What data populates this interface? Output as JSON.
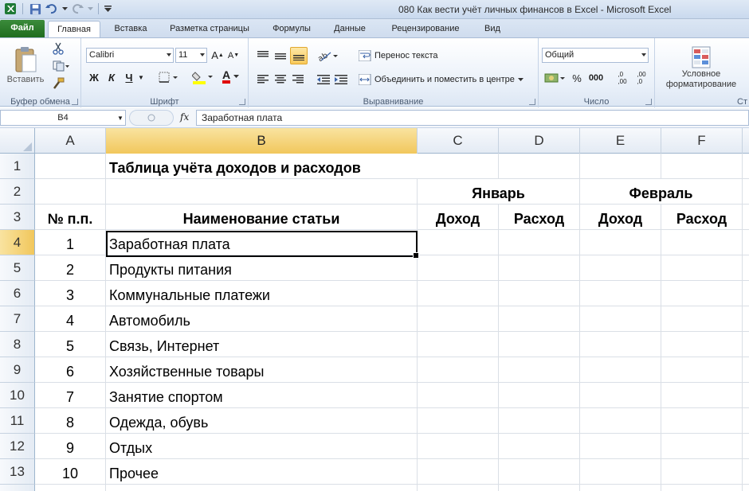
{
  "window": {
    "title": "080 Как вести учёт личных финансов в Excel  -  Microsoft Excel"
  },
  "tabs": [
    {
      "label": "Файл"
    },
    {
      "label": "Главная"
    },
    {
      "label": "Вставка"
    },
    {
      "label": "Разметка страницы"
    },
    {
      "label": "Формулы"
    },
    {
      "label": "Данные"
    },
    {
      "label": "Рецензирование"
    },
    {
      "label": "Вид"
    }
  ],
  "ribbon": {
    "clipboard": {
      "label": "Буфер обмена",
      "paste": "Вставить"
    },
    "font": {
      "label": "Шрифт",
      "font_name": "Calibri",
      "font_size": "11",
      "bold": "Ж",
      "italic": "К",
      "underline": "Ч",
      "grow": "A",
      "shrink": "A",
      "color_a": "A"
    },
    "alignment": {
      "label": "Выравнивание",
      "wrap_text": "Перенос текста",
      "merge_center": "Объединить и поместить в центре"
    },
    "number": {
      "label": "Число",
      "format": "Общий",
      "percent": "%",
      "thousands": "000",
      "inc_decimal": ",0\n,00",
      "dec_decimal": ",00\n,0"
    },
    "styles": {
      "label": "Ст",
      "conditional": "Условное\nформатирование"
    }
  },
  "formula_bar": {
    "name_box": "B4",
    "fx": "fx",
    "content": "Заработная плата"
  },
  "colors": {
    "selected_header": "#f1c75c",
    "file_tab": "#1f6d1f"
  },
  "sheet": {
    "columns": [
      "A",
      "B",
      "C",
      "D",
      "E",
      "F"
    ],
    "rows": [
      "1",
      "2",
      "3",
      "4",
      "5",
      "6",
      "7",
      "8",
      "9",
      "10",
      "11",
      "12",
      "13"
    ],
    "selected_cell": "B4",
    "title": "Таблица учёта доходов и расходов",
    "months": [
      "Январь",
      "Февраль"
    ],
    "headers": {
      "num": "№ п.п.",
      "name": "Наименование статьи",
      "income": "Доход",
      "expense": "Расход"
    },
    "items": [
      {
        "num": "1",
        "name": "Заработная плата"
      },
      {
        "num": "2",
        "name": "Продукты питания"
      },
      {
        "num": "3",
        "name": "Коммунальные платежи"
      },
      {
        "num": "4",
        "name": "Автомобиль"
      },
      {
        "num": "5",
        "name": "Связь, Интернет"
      },
      {
        "num": "6",
        "name": "Хозяйственные товары"
      },
      {
        "num": "7",
        "name": "Занятие спортом"
      },
      {
        "num": "8",
        "name": "Одежда, обувь"
      },
      {
        "num": "9",
        "name": "Отдых"
      },
      {
        "num": "10",
        "name": "Прочее"
      }
    ]
  }
}
